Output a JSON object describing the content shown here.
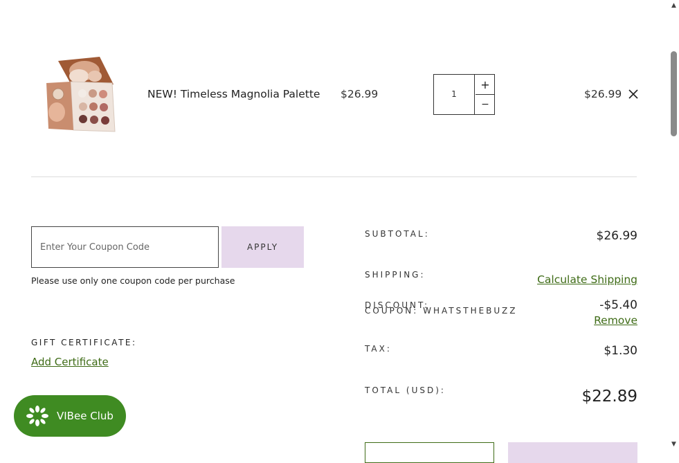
{
  "cart": {
    "item": {
      "name": "NEW! Timeless Magnolia Palette",
      "price": "$26.99",
      "quantity": "1",
      "qty_plus": "+",
      "qty_minus": "−",
      "line_total": "$26.99"
    }
  },
  "coupon": {
    "placeholder": "Enter Your Coupon Code",
    "apply_label": "APPLY",
    "note": "Please use only one coupon code per purchase"
  },
  "gift": {
    "label": "GIFT CERTIFICATE:",
    "add_link": "Add Certificate"
  },
  "summary": {
    "subtotal_label": "SUBTOTAL:",
    "subtotal_value": "$26.99",
    "shipping_label": "SHIPPING:",
    "shipping_link": "Calculate Shipping",
    "discount_label": "DISCOUNT:",
    "coupon_label": "COUPON: WHATSTHEBUZZ",
    "discount_value": "-$5.40",
    "remove_link": "Remove",
    "tax_label": "TAX:",
    "tax_value": "$1.30",
    "total_label": "TOTAL (USD):",
    "total_value": "$22.89"
  },
  "club": {
    "label": "VIBee Club"
  },
  "colors": {
    "accent_green": "#3e6b16",
    "lavender": "#e6d8ec",
    "club_green": "#3f8b22"
  }
}
